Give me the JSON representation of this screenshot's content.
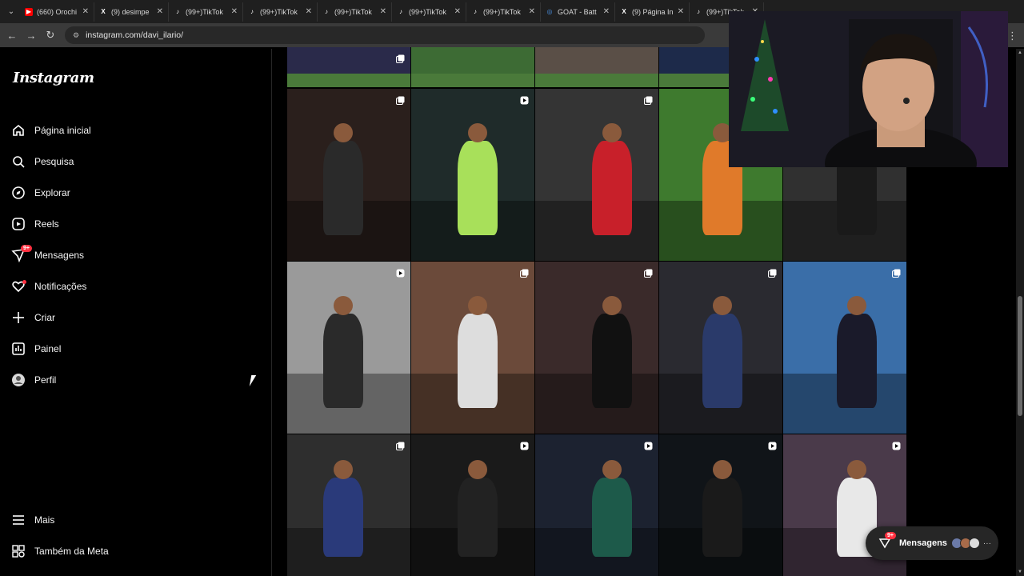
{
  "browser": {
    "tabs": [
      {
        "title": "(660) Orochi",
        "icon": "youtube-icon",
        "color": "#ff0000"
      },
      {
        "title": "(9) desimpe",
        "icon": "x-icon",
        "color": "#ffffff"
      },
      {
        "title": "(99+)TikTok",
        "icon": "tiktok-icon",
        "color": "#ffffff"
      },
      {
        "title": "(99+)TikTok",
        "icon": "tiktok-icon",
        "color": "#ffffff"
      },
      {
        "title": "(99+)TikTok",
        "icon": "tiktok-icon",
        "color": "#ffffff"
      },
      {
        "title": "(99+)TikTok",
        "icon": "tiktok-icon",
        "color": "#ffffff"
      },
      {
        "title": "(99+)TikTok",
        "icon": "tiktok-icon",
        "color": "#ffffff"
      },
      {
        "title": "GOAT - Batt",
        "icon": "globe-icon",
        "color": "#4a90e2"
      },
      {
        "title": "(9) Página In",
        "icon": "x-icon",
        "color": "#ffffff"
      },
      {
        "title": "(99+)TikTok",
        "icon": "tiktok-icon",
        "color": "#ffffff"
      }
    ],
    "url": "instagram.com/davi_ilario/"
  },
  "sidebar": {
    "logo": "Instagram",
    "items": [
      {
        "label": "Página inicial",
        "icon": "home-icon"
      },
      {
        "label": "Pesquisa",
        "icon": "search-icon"
      },
      {
        "label": "Explorar",
        "icon": "compass-icon"
      },
      {
        "label": "Reels",
        "icon": "reels-icon"
      },
      {
        "label": "Mensagens",
        "icon": "messenger-icon",
        "badge": "9+"
      },
      {
        "label": "Notificações",
        "icon": "heart-icon"
      },
      {
        "label": "Criar",
        "icon": "plus-icon"
      },
      {
        "label": "Painel",
        "icon": "chart-icon"
      },
      {
        "label": "Perfil",
        "icon": "avatar-icon"
      }
    ],
    "bottom_items": [
      {
        "label": "Mais",
        "icon": "menu-icon"
      },
      {
        "label": "Também da Meta",
        "icon": "meta-icon"
      }
    ]
  },
  "grid": {
    "posts": [
      {
        "row": 0,
        "type": "carousel",
        "bg": "#2a2a4a"
      },
      {
        "row": 0,
        "type": "none",
        "bg": "#3d6b34"
      },
      {
        "row": 0,
        "type": "none",
        "bg": "#5a4f47"
      },
      {
        "row": 0,
        "type": "none",
        "bg": "#1d2a4a"
      },
      {
        "row": 1,
        "type": "carousel",
        "bg": "#2a1f1c"
      },
      {
        "row": 1,
        "type": "reel",
        "bg": "#1f2b2a"
      },
      {
        "row": 1,
        "type": "carousel",
        "bg": "#343434"
      },
      {
        "row": 1,
        "type": "none",
        "bg": "#3e7a2e"
      },
      {
        "row": 1,
        "type": "none",
        "bg": "#303030"
      },
      {
        "row": 2,
        "type": "reel",
        "bg": "#9a9a9a"
      },
      {
        "row": 2,
        "type": "carousel",
        "bg": "#6b4a3a"
      },
      {
        "row": 2,
        "type": "carousel",
        "bg": "#3a2a2a"
      },
      {
        "row": 2,
        "type": "carousel",
        "bg": "#2a2a30"
      },
      {
        "row": 2,
        "type": "carousel",
        "bg": "#3a6ea8"
      },
      {
        "row": 3,
        "type": "carousel",
        "bg": "#2e2e2e"
      },
      {
        "row": 3,
        "type": "reel",
        "bg": "#1a1a1a"
      },
      {
        "row": 3,
        "type": "reel",
        "bg": "#1c2230"
      },
      {
        "row": 3,
        "type": "reel",
        "bg": "#101418"
      },
      {
        "row": 3,
        "type": "reel",
        "bg": "#4a3a4a"
      }
    ]
  },
  "messages_button": {
    "label": "Mensagens",
    "badge": "9+"
  }
}
